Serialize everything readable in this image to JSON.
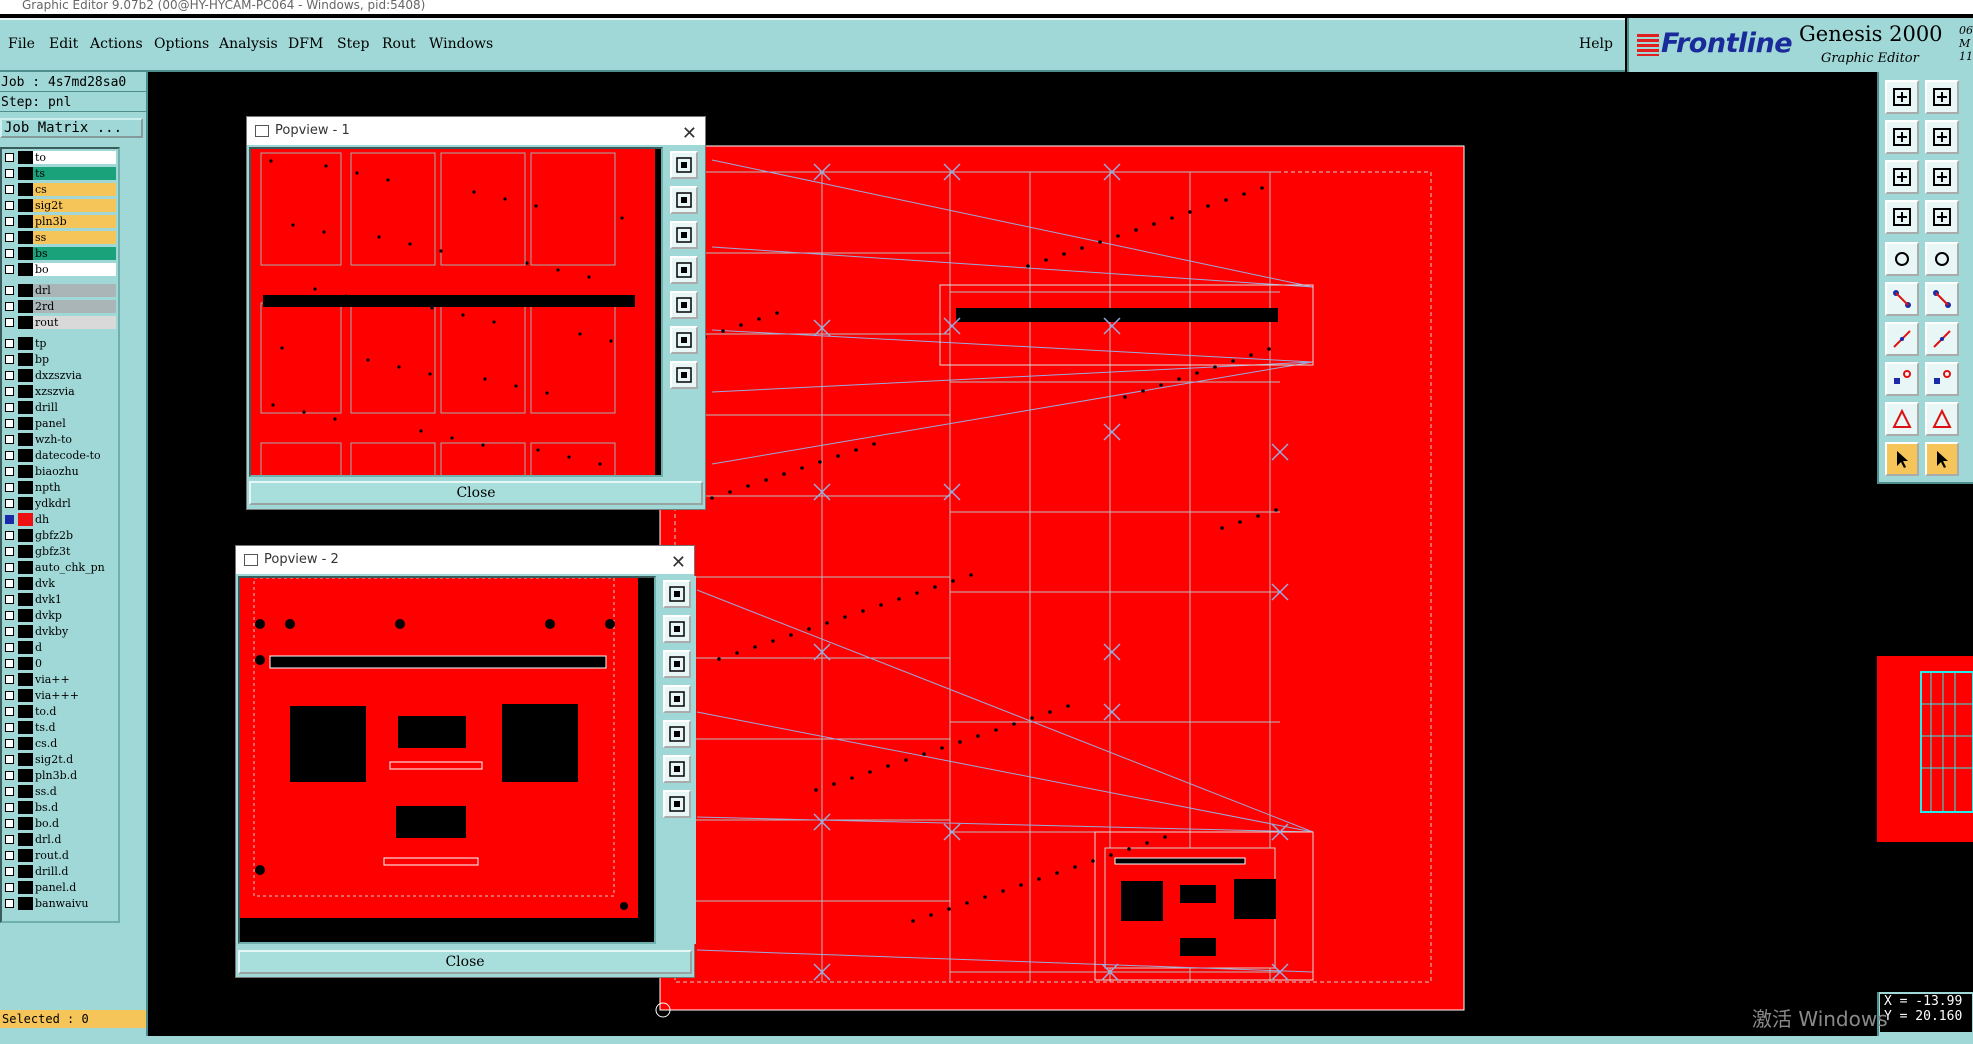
{
  "window": {
    "title": "Graphic Editor 9.07b2 (00@HY-HYCAM-PC064 - Windows, pid:5408)"
  },
  "menu": {
    "items": [
      "File",
      "Edit",
      "Actions",
      "Options",
      "Analysis",
      "DFM",
      "Step",
      "Rout",
      "Windows"
    ],
    "help": "Help"
  },
  "brand": {
    "logo": "Frontline",
    "product": "Genesis 2000",
    "subtitle": "Graphic Editor",
    "date": "06 M\n11:"
  },
  "job": {
    "job_label": "Job : 4s7md28sa0",
    "step_label": "Step: pnl",
    "matrix_button": "Job Matrix ..."
  },
  "layers": [
    {
      "name": "to",
      "bg": "#ffffff",
      "tag": "#000000",
      "checked": false,
      "group": 0
    },
    {
      "name": "ts",
      "bg": "#1aa37a",
      "tag": "#000000",
      "checked": false,
      "group": 0
    },
    {
      "name": "cs",
      "bg": "#f5c55a",
      "tag": "#000000",
      "checked": false,
      "group": 0
    },
    {
      "name": "sig2t",
      "bg": "#f5c55a",
      "tag": "#000000",
      "checked": false,
      "group": 0
    },
    {
      "name": "pln3b",
      "bg": "#f5c55a",
      "tag": "#000000",
      "checked": false,
      "group": 0
    },
    {
      "name": "ss",
      "bg": "#f5c55a",
      "tag": "#000000",
      "checked": false,
      "group": 0
    },
    {
      "name": "bs",
      "bg": "#1aa37a",
      "tag": "#000000",
      "checked": false,
      "group": 0
    },
    {
      "name": "bo",
      "bg": "#ffffff",
      "tag": "#000000",
      "checked": false,
      "group": 0
    },
    {
      "name": "drl",
      "bg": "#a9b5b7",
      "tag": "#000000",
      "checked": false,
      "group": 1
    },
    {
      "name": "2rd",
      "bg": "#a9b5b7",
      "tag": "#000000",
      "checked": false,
      "group": 1
    },
    {
      "name": "rout",
      "bg": "#d9d9d9",
      "tag": "#000000",
      "checked": false,
      "group": 1
    },
    {
      "name": "tp",
      "bg": "#9fd8d6",
      "tag": "#000000",
      "checked": false,
      "group": 2
    },
    {
      "name": "bp",
      "bg": "#9fd8d6",
      "tag": "#000000",
      "checked": false,
      "group": 2
    },
    {
      "name": "dxzszvia",
      "bg": "#9fd8d6",
      "tag": "#000000",
      "checked": false,
      "group": 2
    },
    {
      "name": "xzszvia",
      "bg": "#9fd8d6",
      "tag": "#000000",
      "checked": false,
      "group": 2
    },
    {
      "name": "drill",
      "bg": "#9fd8d6",
      "tag": "#000000",
      "checked": false,
      "group": 2
    },
    {
      "name": "panel",
      "bg": "#9fd8d6",
      "tag": "#000000",
      "checked": false,
      "group": 2
    },
    {
      "name": "wzh-to",
      "bg": "#9fd8d6",
      "tag": "#000000",
      "checked": false,
      "group": 2
    },
    {
      "name": "datecode-to",
      "bg": "#9fd8d6",
      "tag": "#000000",
      "checked": false,
      "group": 2
    },
    {
      "name": "biaozhu",
      "bg": "#9fd8d6",
      "tag": "#000000",
      "checked": false,
      "group": 2
    },
    {
      "name": "npth",
      "bg": "#9fd8d6",
      "tag": "#000000",
      "checked": false,
      "group": 2
    },
    {
      "name": "ydkdrl",
      "bg": "#9fd8d6",
      "tag": "#000000",
      "checked": false,
      "group": 2
    },
    {
      "name": "dh",
      "bg": "#9fd8d6",
      "tag": "#ee1111",
      "checked": true,
      "group": 2
    },
    {
      "name": "gbfz2b",
      "bg": "#9fd8d6",
      "tag": "#000000",
      "checked": false,
      "group": 2
    },
    {
      "name": "gbfz3t",
      "bg": "#9fd8d6",
      "tag": "#000000",
      "checked": false,
      "group": 2
    },
    {
      "name": "auto_chk_pn",
      "bg": "#9fd8d6",
      "tag": "#000000",
      "checked": false,
      "group": 2
    },
    {
      "name": "dvk",
      "bg": "#9fd8d6",
      "tag": "#000000",
      "checked": false,
      "group": 2
    },
    {
      "name": "dvk1",
      "bg": "#9fd8d6",
      "tag": "#000000",
      "checked": false,
      "group": 2
    },
    {
      "name": "dvkp",
      "bg": "#9fd8d6",
      "tag": "#000000",
      "checked": false,
      "group": 2
    },
    {
      "name": "dvkby",
      "bg": "#9fd8d6",
      "tag": "#000000",
      "checked": false,
      "group": 2
    },
    {
      "name": "d",
      "bg": "#9fd8d6",
      "tag": "#000000",
      "checked": false,
      "group": 2
    },
    {
      "name": "0",
      "bg": "#9fd8d6",
      "tag": "#000000",
      "checked": false,
      "group": 2
    },
    {
      "name": "via++",
      "bg": "#9fd8d6",
      "tag": "#000000",
      "checked": false,
      "group": 2
    },
    {
      "name": "via+++",
      "bg": "#9fd8d6",
      "tag": "#000000",
      "checked": false,
      "group": 2
    },
    {
      "name": "to.d",
      "bg": "#9fd8d6",
      "tag": "#000000",
      "checked": false,
      "group": 2
    },
    {
      "name": "ts.d",
      "bg": "#9fd8d6",
      "tag": "#000000",
      "checked": false,
      "group": 2
    },
    {
      "name": "cs.d",
      "bg": "#9fd8d6",
      "tag": "#000000",
      "checked": false,
      "group": 2
    },
    {
      "name": "sig2t.d",
      "bg": "#9fd8d6",
      "tag": "#000000",
      "checked": false,
      "group": 2
    },
    {
      "name": "pln3b.d",
      "bg": "#9fd8d6",
      "tag": "#000000",
      "checked": false,
      "group": 2
    },
    {
      "name": "ss.d",
      "bg": "#9fd8d6",
      "tag": "#000000",
      "checked": false,
      "group": 2
    },
    {
      "name": "bs.d",
      "bg": "#9fd8d6",
      "tag": "#000000",
      "checked": false,
      "group": 2
    },
    {
      "name": "bo.d",
      "bg": "#9fd8d6",
      "tag": "#000000",
      "checked": false,
      "group": 2
    },
    {
      "name": "drl.d",
      "bg": "#9fd8d6",
      "tag": "#000000",
      "checked": false,
      "group": 2
    },
    {
      "name": "rout.d",
      "bg": "#9fd8d6",
      "tag": "#000000",
      "checked": false,
      "group": 2
    },
    {
      "name": "drill.d",
      "bg": "#9fd8d6",
      "tag": "#000000",
      "checked": false,
      "group": 2
    },
    {
      "name": "panel.d",
      "bg": "#9fd8d6",
      "tag": "#000000",
      "checked": false,
      "group": 2
    },
    {
      "name": "banwaivu",
      "bg": "#9fd8d6",
      "tag": "#000000",
      "checked": false,
      "group": 2
    }
  ],
  "status": {
    "selected": "Selected : 0"
  },
  "coords": {
    "x": "X = -13.99",
    "y": "Y = 20.160"
  },
  "popview1": {
    "title": "Popview - 1",
    "close_label": "Close"
  },
  "popview2": {
    "title": "Popview - 2",
    "close_label": "Close"
  },
  "watermark": "激活 Windows",
  "colors": {
    "accent": "#9fd8d6",
    "board": "#ff0000",
    "panel_dark": "#4e8f8d",
    "highlight": "#f5c55a"
  }
}
